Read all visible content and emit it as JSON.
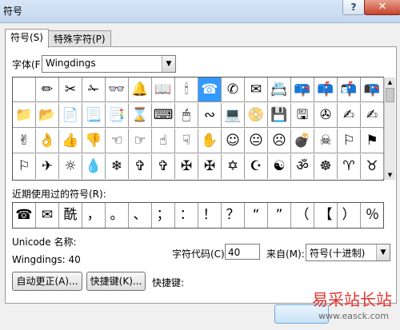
{
  "window": {
    "title": "符号",
    "help_label": "?",
    "close_label": "✕"
  },
  "tabs": [
    {
      "label": "符号(S)",
      "active": true
    },
    {
      "label": "特殊字符(P)",
      "active": false
    }
  ],
  "font": {
    "label": "字体(F):",
    "value": "Wingdings"
  },
  "symbols": [
    "",
    "✏",
    "✂",
    "✁",
    "👓",
    "🔔",
    "📖",
    "🕯",
    "☎",
    "✆",
    "✉",
    "📇",
    "📪",
    "📫",
    "📬",
    "📭",
    "📁",
    "📂",
    "📄",
    "📃",
    "📑",
    "⌛",
    "⌨",
    "🖱",
    "∾",
    "💻",
    "📀",
    "💾",
    "🖫",
    "✇",
    "✍",
    "✍",
    "✌",
    "👌",
    "👍",
    "👎",
    "☜",
    "☞",
    "☝",
    "☟",
    "✋",
    "☺",
    "😐",
    "☹",
    "💣",
    "☠",
    "⚐",
    "⚑",
    "⚐",
    "✈",
    "☼",
    "💧",
    "❄",
    "✞",
    "✞",
    "✠",
    "✠",
    "✡",
    "☪",
    "☯",
    "ॐ",
    "☸",
    "♈",
    "♉"
  ],
  "selected_index": 8,
  "recent": {
    "label": "近期使用过的符号(R):",
    "items": [
      "☎",
      "✉",
      "酰",
      "，",
      "。",
      "、",
      "；",
      "：",
      "！",
      "？",
      "“",
      "”",
      "（",
      "【",
      "）",
      "％"
    ]
  },
  "unicode_name_label": "Unicode 名称:",
  "char_desc": "Wingdings: 40",
  "char_code": {
    "label": "字符代码(C):",
    "value": "40"
  },
  "from": {
    "label": "来自(M):",
    "value": "符号(十进制)"
  },
  "buttons": {
    "autocorrect": "自动更正(A)...",
    "shortcut": "快捷键(K)...",
    "shortcut_key_label": "快捷键:"
  },
  "watermark": {
    "title": "易采站长站",
    "url": "www.easck.com"
  }
}
